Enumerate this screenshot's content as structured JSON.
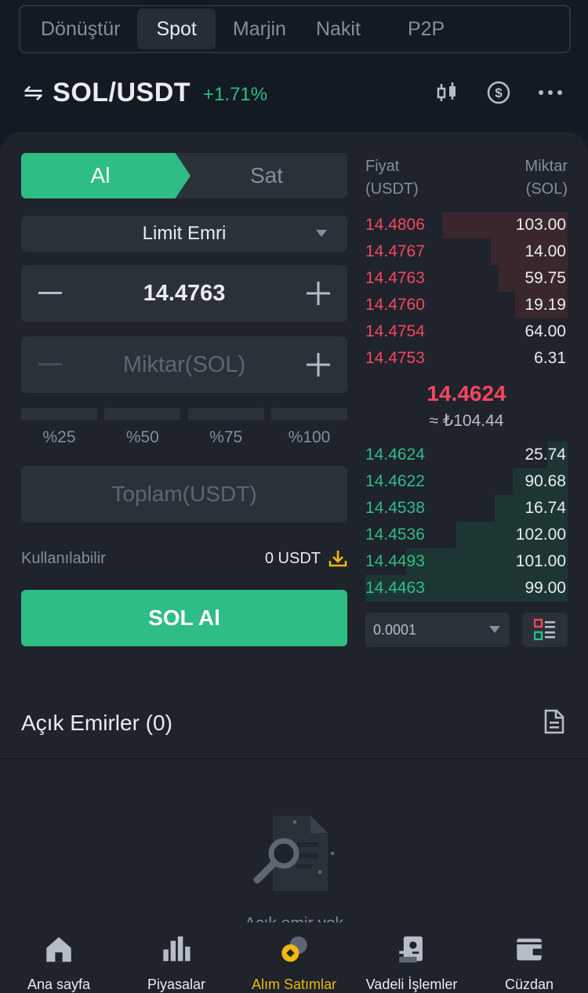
{
  "tabs": [
    "Dönüştür",
    "Spot",
    "Marjin",
    "Nakit",
    "P2P"
  ],
  "active_tab": "Spot",
  "pair": {
    "name": "SOL/USDT",
    "change": "+1.71%"
  },
  "header_icons": [
    "candlestick-icon",
    "dollar-circle-icon",
    "more-icon"
  ],
  "trade": {
    "buy_label": "Al",
    "sell_label": "Sat",
    "order_type": "Limit Emri",
    "price_value": "14.4763",
    "quantity_placeholder": "Miktar(SOL)",
    "percentages": [
      "%25",
      "%50",
      "%75",
      "%100"
    ],
    "total_placeholder": "Toplam(USDT)",
    "available_label": "Kullanılabilir",
    "available_value": "0 USDT",
    "buy_button": "SOL Al"
  },
  "orderbook": {
    "price_header": "Fiyat\n(USDT)",
    "price_header_1": "Fiyat",
    "price_header_2": "(USDT)",
    "qty_header_1": "Miktar",
    "qty_header_2": "(SOL)",
    "asks": [
      {
        "price": "14.4806",
        "qty": "103.00",
        "depth": 0.62
      },
      {
        "price": "14.4767",
        "qty": "14.00",
        "depth": 0.38
      },
      {
        "price": "14.4763",
        "qty": "59.75",
        "depth": 0.34
      },
      {
        "price": "14.4760",
        "qty": "19.19",
        "depth": 0.26
      },
      {
        "price": "14.4754",
        "qty": "64.00",
        "depth": 0.0
      },
      {
        "price": "14.4753",
        "qty": "6.31",
        "depth": 0.0
      }
    ],
    "last_price": "14.4624",
    "last_price_fiat": "≈ ₺104.44",
    "bids": [
      {
        "price": "14.4624",
        "qty": "25.74",
        "depth": 0.1
      },
      {
        "price": "14.4622",
        "qty": "90.68",
        "depth": 0.27
      },
      {
        "price": "14.4538",
        "qty": "16.74",
        "depth": 0.36
      },
      {
        "price": "14.4536",
        "qty": "102.00",
        "depth": 0.55
      },
      {
        "price": "14.4493",
        "qty": "101.00",
        "depth": 0.8
      },
      {
        "price": "14.4463",
        "qty": "99.00",
        "depth": 1.0
      }
    ],
    "precision": "0.0001"
  },
  "open_orders": {
    "title": "Açık Emirler (0)",
    "empty_text": "Açık emir yok"
  },
  "nav": [
    {
      "label": "Ana sayfa",
      "icon": "home-icon"
    },
    {
      "label": "Piyasalar",
      "icon": "markets-icon"
    },
    {
      "label": "Alım Satımlar",
      "icon": "trade-icon"
    },
    {
      "label": "Vadeli İşlemler",
      "icon": "futures-icon"
    },
    {
      "label": "Cüzdan",
      "icon": "wallet-icon"
    }
  ],
  "active_nav": "Alım Satımlar",
  "colors": {
    "green": "#2ebd85",
    "red": "#f6465d",
    "yellow": "#f0b90b",
    "bg": "#141a23",
    "panel": "#1e232c"
  }
}
